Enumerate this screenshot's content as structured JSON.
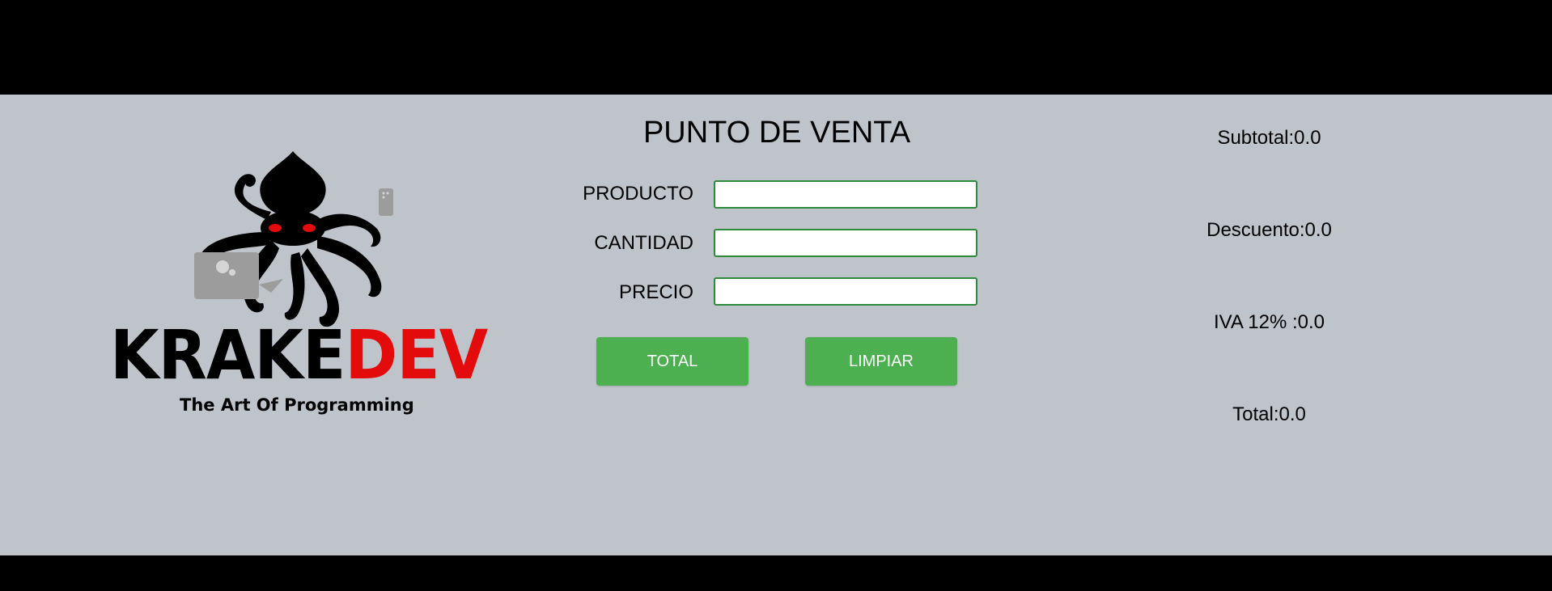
{
  "logo": {
    "word_black": "KRAKE",
    "word_red": "DEV",
    "tagline": "The Art Of Programming",
    "icon": "octopus-icon",
    "accent_color": "#e30b0b"
  },
  "form": {
    "title": "PUNTO DE VENTA",
    "fields": [
      {
        "label": "PRODUCTO",
        "value": ""
      },
      {
        "label": "CANTIDAD",
        "value": ""
      },
      {
        "label": "PRECIO",
        "value": ""
      }
    ],
    "buttons": {
      "total_label": "TOTAL",
      "clear_label": "LIMPIAR"
    },
    "button_color": "#4caf50",
    "input_border_color": "#2e8b3c"
  },
  "summary": {
    "subtotal": "Subtotal:0.0",
    "descuento": "Descuento:0.0",
    "iva": "IVA 12% :0.0",
    "total": "Total:0.0"
  }
}
